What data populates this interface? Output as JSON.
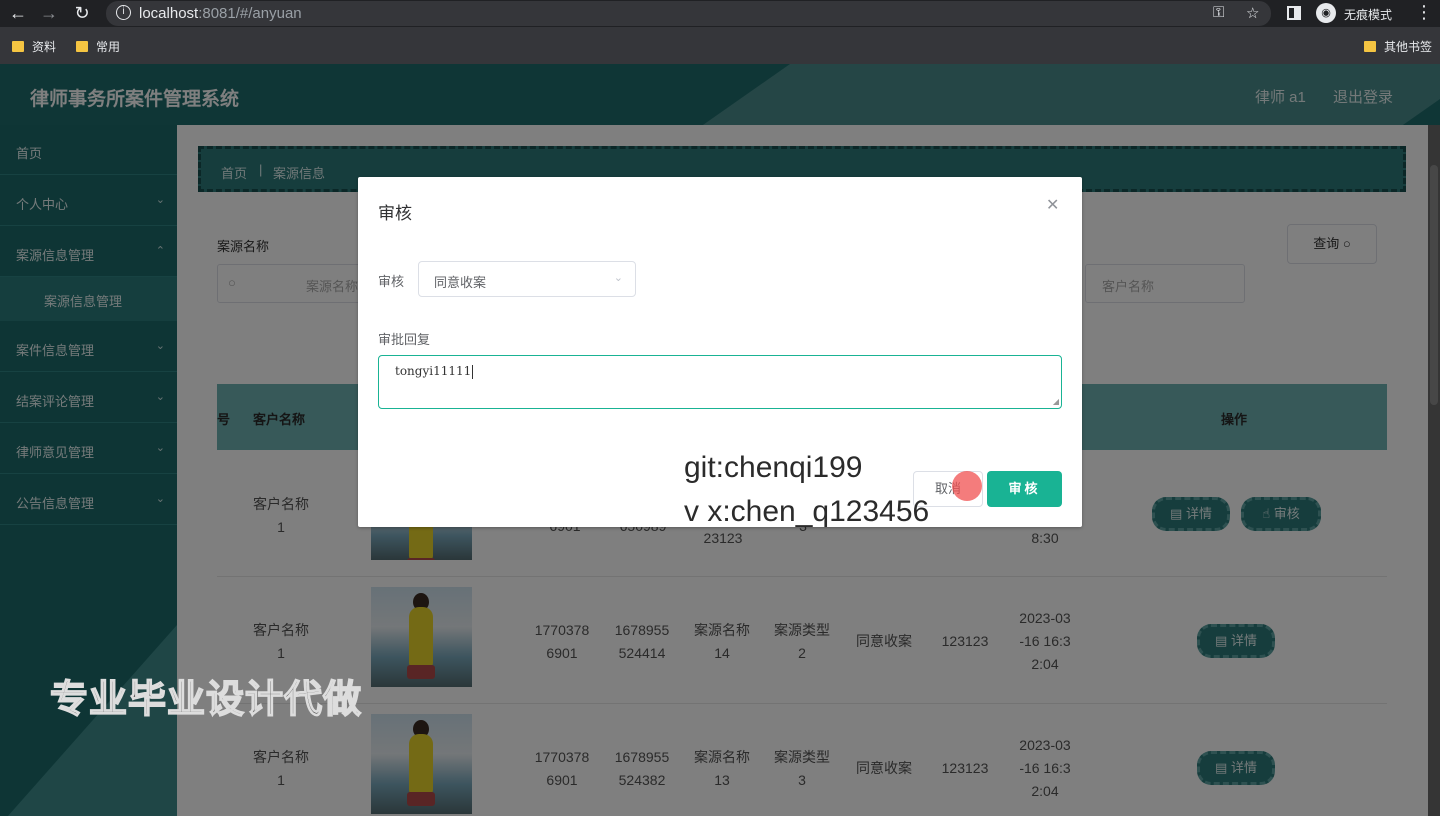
{
  "browser": {
    "url_host": "localhost",
    "url_rest": ":8081/#/anyuan",
    "incognito_label": "无痕模式",
    "bookmarks": [
      "资料",
      "常用"
    ],
    "other_bookmarks": "其他书签"
  },
  "header": {
    "title": "律师事务所案件管理系统",
    "user": "律师 a1",
    "logout": "退出登录"
  },
  "sidebar": {
    "items": [
      {
        "label": "首页"
      },
      {
        "label": "个人中心"
      },
      {
        "label": "案源信息管理"
      },
      {
        "label": "案件信息管理"
      },
      {
        "label": "结案评论管理"
      },
      {
        "label": "律师意见管理"
      },
      {
        "label": "公告信息管理"
      }
    ],
    "sub_item": "案源信息管理"
  },
  "breadcrumb": {
    "home": "首页",
    "sep": "|",
    "current": "案源信息"
  },
  "search": {
    "label": "案源名称",
    "placeholder": "案源名称",
    "customer_placeholder": "客户名称",
    "query_button": "查询"
  },
  "table": {
    "headers": {
      "partial": "号",
      "customer": "客户名称",
      "actions": "操作"
    },
    "rows": [
      {
        "customer": "客户名称\n1",
        "phone": "6901",
        "id": "650989",
        "name": "23123",
        "type": "3",
        "status": "",
        "reply": "",
        "time": "8:30",
        "actions": [
          "详情",
          "审核"
        ]
      },
      {
        "customer": "客户名称\n1",
        "phone": "1770378\n6901",
        "id": "1678955\n524414",
        "name": "案源名称\n14",
        "type": "案源类型\n2",
        "status": "同意收案",
        "reply": "123123",
        "time": "2023-03\n-16 16:3\n2:04",
        "actions": [
          "详情"
        ]
      },
      {
        "customer": "客户名称\n1",
        "phone": "1770378\n6901",
        "id": "1678955\n524382",
        "name": "案源名称\n13",
        "type": "案源类型\n3",
        "status": "同意收案",
        "reply": "123123",
        "time": "2023-03\n-16 16:3\n2:04",
        "actions": [
          "详情"
        ]
      }
    ]
  },
  "dialog": {
    "title": "审核",
    "field_label": "审核",
    "select_value": "同意收案",
    "reply_label": "审批回复",
    "reply_value": "tongyi11111",
    "cancel": "取消",
    "submit": "审核"
  },
  "watermarks": {
    "line1": "git:chenqi199",
    "line2": "v x:chen_q123456",
    "big": "专业毕业设计代做"
  }
}
